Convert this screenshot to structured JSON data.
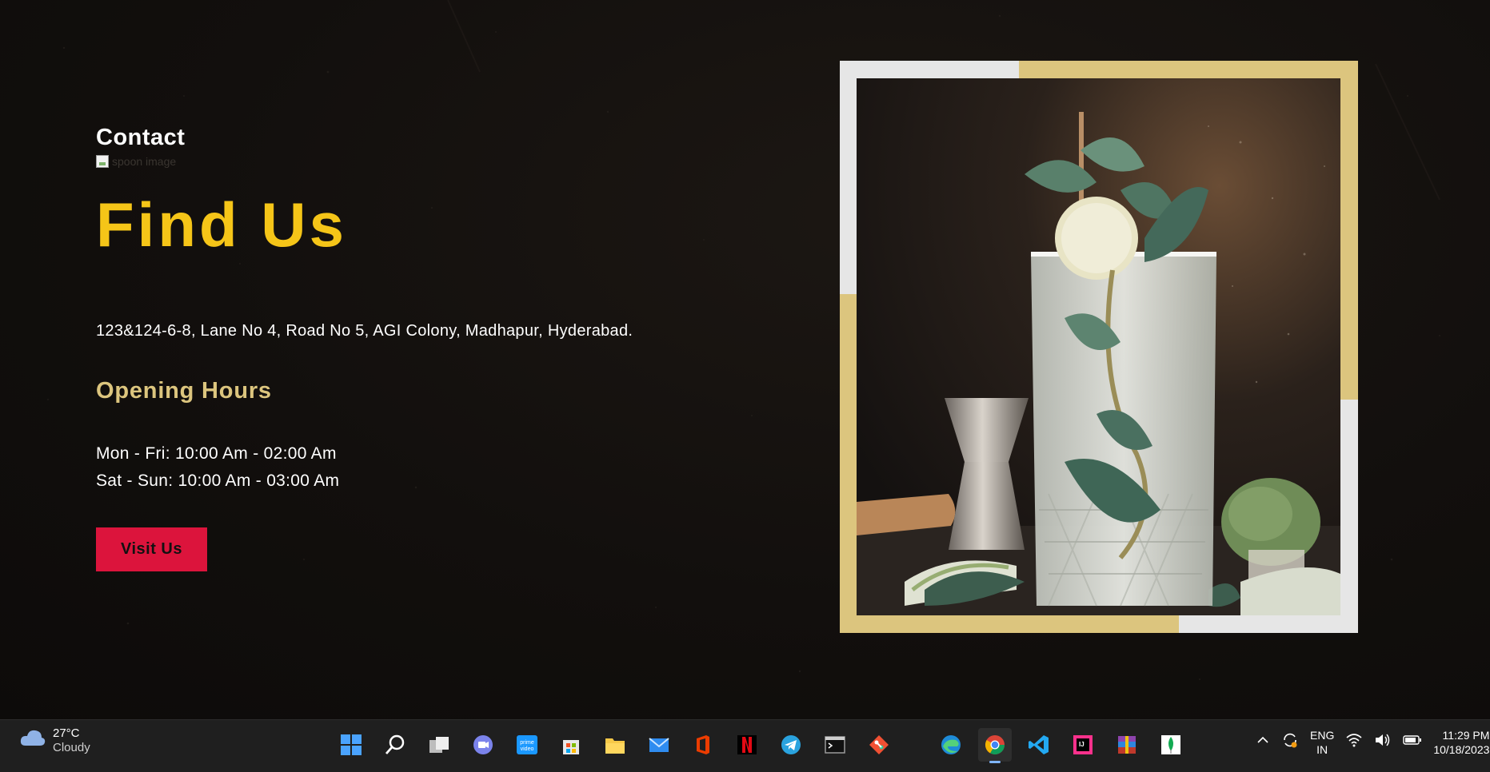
{
  "contact": {
    "kicker": "Contact",
    "spoon_image_alt": "spoon image",
    "title": "Find Us",
    "address": "123&124-6-8, Lane No 4, Road No 5, AGI Colony, Madhapur, Hyderabad.",
    "hours_title": "Opening Hours",
    "hours": [
      "Mon - Fri: 10:00 Am - 02:00 Am",
      "Sat - Sun: 10:00 Am - 03:00 Am"
    ],
    "button_label": "Visit Us"
  },
  "image": {
    "icon": "mojito-drink-photo"
  },
  "colors": {
    "title": "#f5c518",
    "hours_title": "#dcc57e",
    "button": "#dc143c",
    "frame_gold": "#dcc57e",
    "frame_light": "#e6e6e6"
  },
  "taskbar": {
    "weather": {
      "temp": "27°C",
      "condition": "Cloudy",
      "icon": "cloud-icon"
    },
    "apps": [
      {
        "name": "windows-start-icon"
      },
      {
        "name": "search-icon"
      },
      {
        "name": "task-view-icon"
      },
      {
        "name": "teams-chat-icon"
      },
      {
        "name": "prime-video-icon"
      },
      {
        "name": "microsoft-store-icon"
      },
      {
        "name": "file-explorer-icon"
      },
      {
        "name": "mail-icon"
      },
      {
        "name": "office-icon"
      },
      {
        "name": "netflix-icon"
      },
      {
        "name": "telegram-icon"
      },
      {
        "name": "terminal-icon"
      },
      {
        "name": "git-icon"
      },
      {
        "name": "edge-icon"
      },
      {
        "name": "chrome-icon"
      },
      {
        "name": "vscode-icon"
      },
      {
        "name": "intellij-icon"
      },
      {
        "name": "winrar-icon"
      },
      {
        "name": "mongodb-icon"
      }
    ],
    "active_app": "chrome-icon",
    "language": {
      "line1": "ENG",
      "line2": "IN"
    },
    "clock": {
      "time": "11:29 PM",
      "date": "10/18/2023"
    }
  }
}
